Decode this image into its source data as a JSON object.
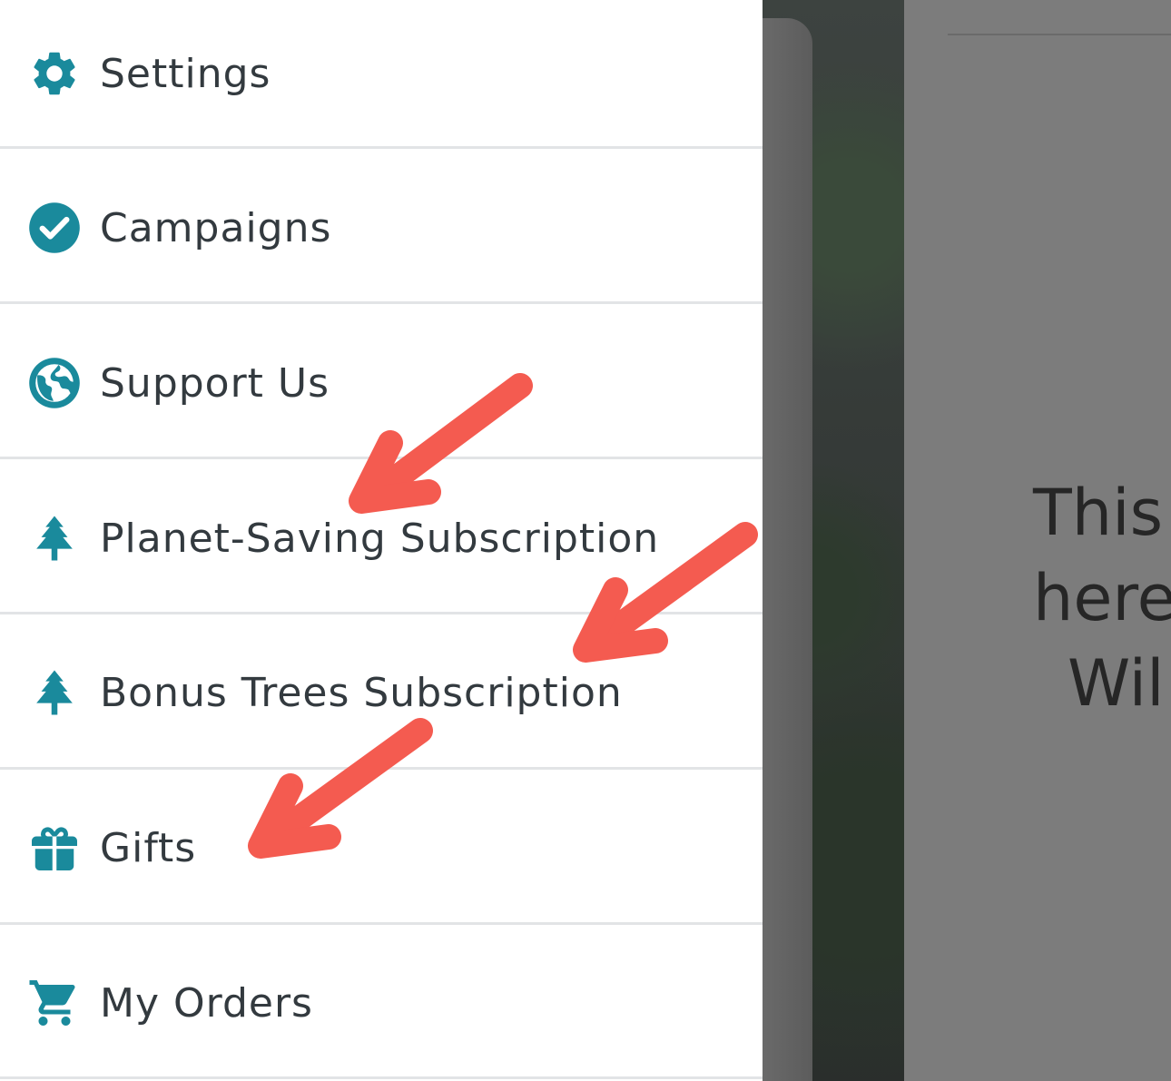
{
  "menu": {
    "items": [
      {
        "label": "Settings",
        "icon": "gear-icon"
      },
      {
        "label": "Campaigns",
        "icon": "check-circle-icon"
      },
      {
        "label": "Support Us",
        "icon": "globe-icon"
      },
      {
        "label": "Planet-Saving Subscription",
        "icon": "tree-icon"
      },
      {
        "label": "Bonus Trees Subscription",
        "icon": "tree-icon"
      },
      {
        "label": "Gifts",
        "icon": "gift-icon"
      },
      {
        "label": "My Orders",
        "icon": "cart-icon"
      }
    ]
  },
  "background": {
    "text_line_1": "This",
    "text_line_2": "here",
    "text_line_3": "Wil"
  },
  "colors": {
    "accent": "#1a8a9c",
    "annotation_arrow": "#f45b50",
    "menu_text": "#333a3f",
    "divider": "#e2e4e6"
  }
}
